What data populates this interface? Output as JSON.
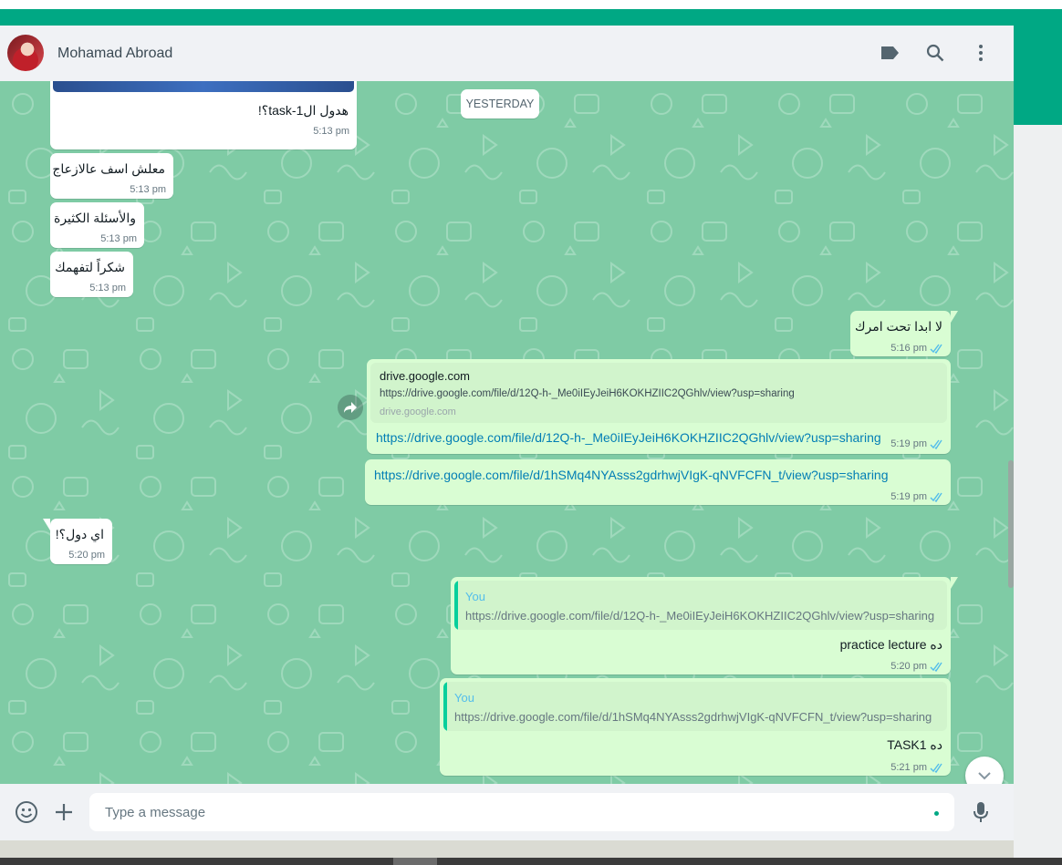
{
  "header": {
    "contact_name": "Mohamad Abroad",
    "icons": [
      "label-icon",
      "search-icon",
      "menu-icon"
    ]
  },
  "chat": {
    "date_divider": "YESTERDAY",
    "incoming": [
      {
        "text": "هدول ال1-task؟!",
        "time": "5:13 pm"
      },
      {
        "text": "معلش اسف عالازعاج",
        "time": "5:13 pm"
      },
      {
        "text": "والأسئلة الكثيرة",
        "time": "5:13 pm"
      },
      {
        "text": "شكراً لتفهمك",
        "time": "5:13 pm"
      },
      {
        "text": "اي دول؟!",
        "time": "5:20 pm"
      }
    ],
    "outgoing_reply": {
      "text": "لا ابدا تحت امرك",
      "time": "5:16 pm"
    },
    "link1": {
      "preview_title": "drive.google.com",
      "preview_url": "https://drive.google.com/file/d/12Q-h-_Me0iIEyJeiH6KOKHZIIC2QGhlv/view?usp=sharing",
      "preview_domain": "drive.google.com",
      "text": "https://drive.google.com/file/d/12Q-h-_Me0iIEyJeiH6KOKHZIIC2QGhlv/view?usp=sharing",
      "time": "5:19 pm"
    },
    "link2": {
      "text": "https://drive.google.com/file/d/1hSMq4NYAsss2gdrhwjVIgK-qNVFCFN_t/view?usp=sharing",
      "time": "5:19 pm"
    },
    "quote1": {
      "author": "You",
      "quoted": "https://drive.google.com/file/d/12Q-h-_Me0iIEyJeiH6KOKHZIIC2QGhlv/view?usp=sharing",
      "text": "ده practice lecture",
      "time": "5:20 pm"
    },
    "quote2": {
      "author": "You",
      "quoted": "https://drive.google.com/file/d/1hSMq4NYAsss2gdrhwjVIgK-qNVFCFN_t/view?usp=sharing",
      "text": "ده TASK1",
      "time": "5:21 pm"
    }
  },
  "footer": {
    "placeholder": "Type a message"
  },
  "colors": {
    "teal": "#00a884",
    "chat_bg": "#7fcba5",
    "outgoing": "#d9fdd3",
    "incoming": "#ffffff",
    "tick_blue": "#53bdeb"
  }
}
